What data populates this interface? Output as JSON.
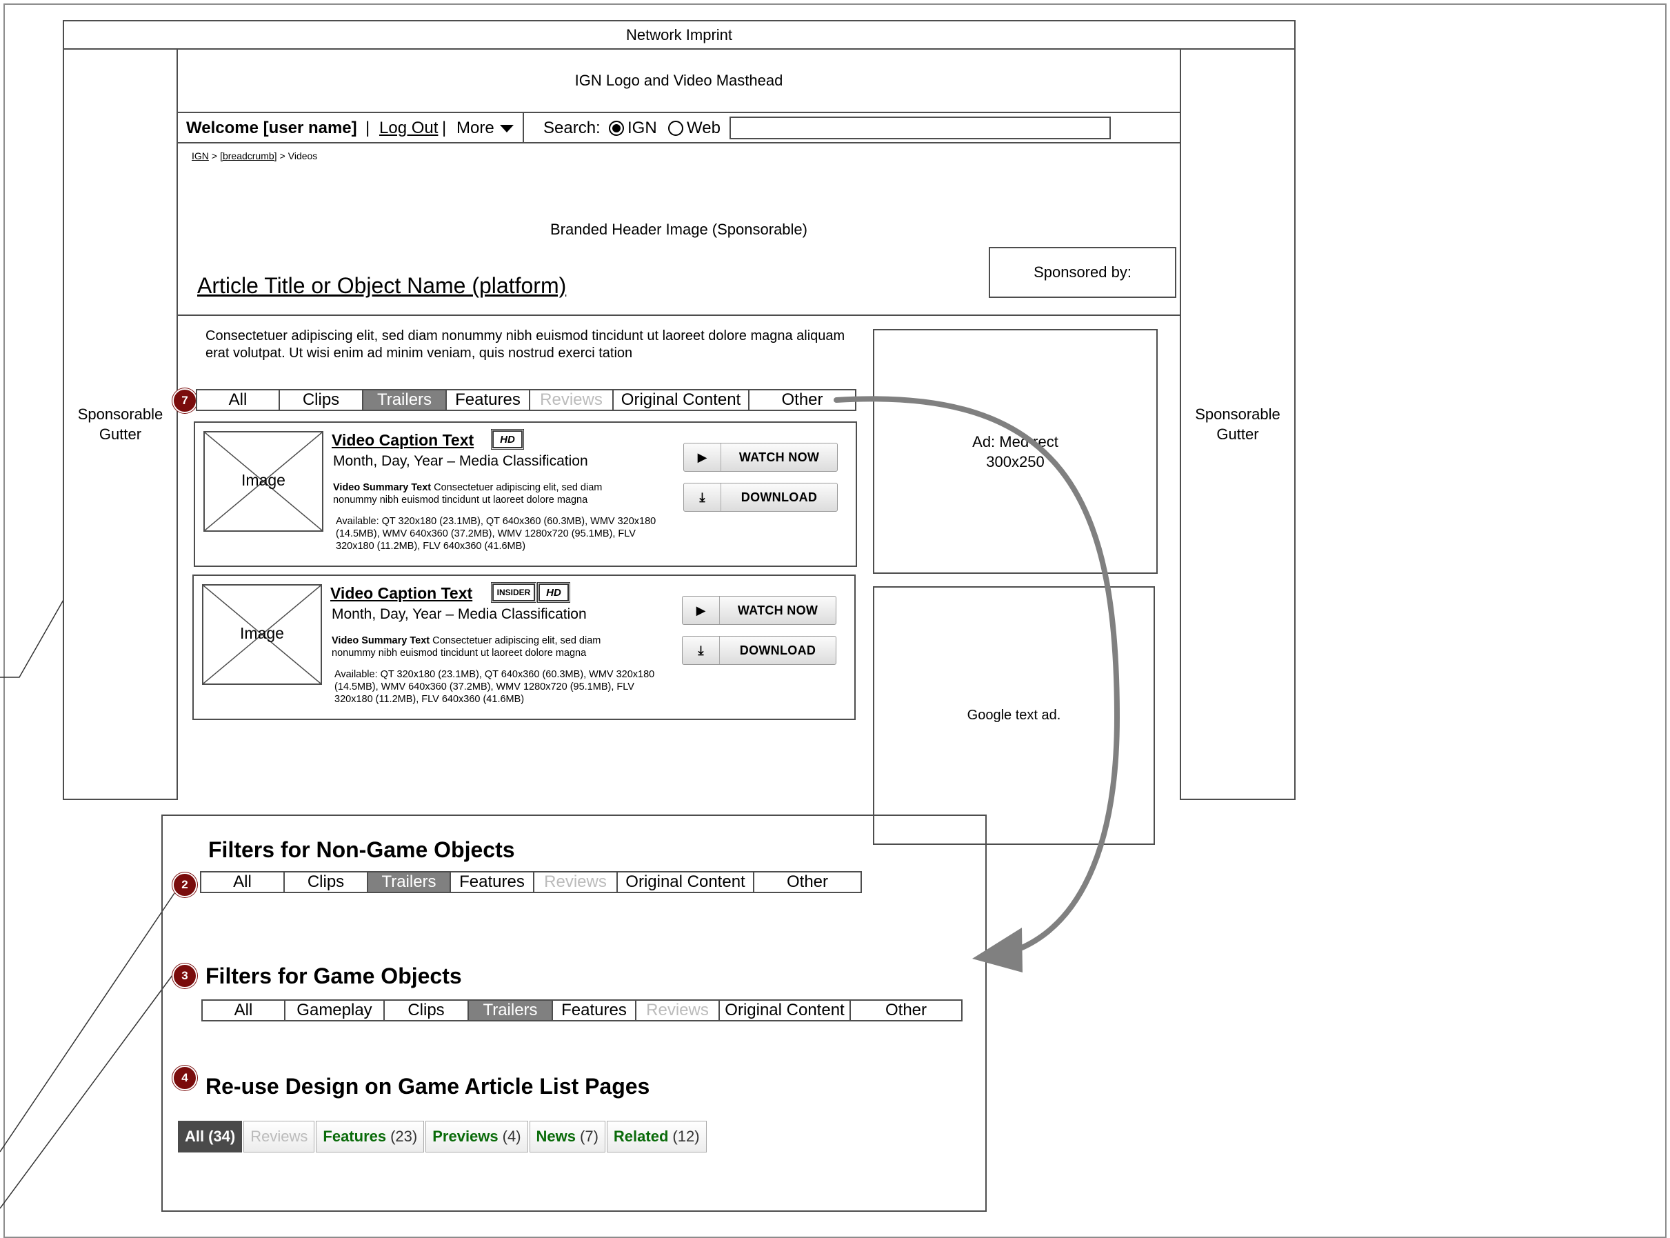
{
  "header": {
    "network_imprint": "Network Imprint",
    "masthead": "IGN Logo and Video Masthead"
  },
  "gutters": {
    "left": "Sponsorable Gutter",
    "right": "Sponsorable Gutter"
  },
  "userbar": {
    "welcome": "Welcome [user name]",
    "sep1": "|",
    "logout": "Log Out",
    "sep2": "|",
    "more": "More",
    "search_label": "Search:",
    "radio_ign": "IGN",
    "radio_web": "Web",
    "search_value": ""
  },
  "breadcrumb": {
    "root": "IGN",
    "sep1": ">",
    "middle": "[breadcrumb]",
    "sep2": ">",
    "current": "Videos"
  },
  "banner": {
    "branded_header": "Branded Header Image (Sponsorable)",
    "title": "Article Title or Object Name (platform)",
    "sponsored_by": "Sponsored by:"
  },
  "intro_text": "Consectetuer adipiscing elit, sed diam nonummy nibh euismod tincidunt ut laoreet dolore magna aliquam erat volutpat. Ut wisi enim ad minim veniam, quis nostrud exerci tation",
  "main_filters": {
    "marker": "7",
    "tabs": [
      {
        "label": "All",
        "state": "normal"
      },
      {
        "label": "Clips",
        "state": "normal"
      },
      {
        "label": "Trailers",
        "state": "active"
      },
      {
        "label": "Features",
        "state": "normal"
      },
      {
        "label": "Reviews",
        "state": "disabled"
      },
      {
        "label": "Original Content",
        "state": "normal"
      },
      {
        "label": "Other",
        "state": "normal"
      }
    ]
  },
  "videos": [
    {
      "image": "Image",
      "caption": "Video Caption Text",
      "badges": [
        "HD"
      ],
      "date_line": "Month, Day, Year – Media Classification",
      "summary_label": "Video Summary Text",
      "summary": "Consectetuer adipiscing elit, sed diam nonummy nibh euismod tincidunt ut laoreet dolore magna",
      "available": "Available: QT 320x180 (23.1MB), QT 640x360 (60.3MB), WMV 320x180 (14.5MB), WMV 640x360 (37.2MB), WMV 1280x720 (95.1MB), FLV 320x180 (11.2MB), FLV 640x360 (41.6MB)",
      "watch": "WATCH NOW",
      "download": "DOWNLOAD"
    },
    {
      "image": "Image",
      "caption": "Video Caption Text",
      "badges": [
        "INSIDER",
        "HD"
      ],
      "date_line": "Month, Day, Year – Media Classification",
      "summary_label": "Video Summary Text",
      "summary": "Consectetuer adipiscing elit, sed diam nonummy nibh euismod tincidunt ut laoreet dolore magna",
      "available": "Available: QT 320x180 (23.1MB), QT 640x360 (60.3MB), WMV 320x180 (14.5MB), WMV 640x360 (37.2MB), WMV 1280x720 (95.1MB), FLV 320x180 (11.2MB), FLV 640x360 (41.6MB)",
      "watch": "WATCH NOW",
      "download": "DOWNLOAD"
    }
  ],
  "ads": {
    "med_rect": "Ad: Med rect\n300x250",
    "google": "Google text ad."
  },
  "panel": {
    "non_game_title": "Filters for Non-Game Objects",
    "non_game_marker": "2",
    "non_game_tabs": [
      {
        "label": "All",
        "state": "normal"
      },
      {
        "label": "Clips",
        "state": "normal"
      },
      {
        "label": "Trailers",
        "state": "active"
      },
      {
        "label": "Features",
        "state": "normal"
      },
      {
        "label": "Reviews",
        "state": "disabled"
      },
      {
        "label": "Original Content",
        "state": "normal"
      },
      {
        "label": "Other",
        "state": "normal"
      }
    ],
    "game_title": "Filters for Game Objects",
    "game_marker": "3",
    "game_tabs": [
      {
        "label": "All",
        "state": "normal"
      },
      {
        "label": "Gameplay",
        "state": "normal"
      },
      {
        "label": "Clips",
        "state": "normal"
      },
      {
        "label": "Trailers",
        "state": "active"
      },
      {
        "label": "Features",
        "state": "normal"
      },
      {
        "label": "Reviews",
        "state": "disabled"
      },
      {
        "label": "Original Content",
        "state": "normal"
      },
      {
        "label": "Other",
        "state": "normal"
      }
    ],
    "reuse_title": "Re-use Design on Game Article List Pages",
    "reuse_marker": "4",
    "reuse_tabs": [
      {
        "label": "All",
        "count": "(34)",
        "state": "active"
      },
      {
        "label": "Reviews",
        "count": "",
        "state": "disabled"
      },
      {
        "label": "Features",
        "count": "(23)",
        "state": "normal"
      },
      {
        "label": "Previews",
        "count": "(4)",
        "state": "normal"
      },
      {
        "label": "News",
        "count": "(7)",
        "state": "normal"
      },
      {
        "label": "Related",
        "count": "(12)",
        "state": "normal"
      }
    ]
  },
  "colors": {
    "marker": "#7a0c0c",
    "active_tab": "#808080",
    "disabled_text": "#bbbbbb",
    "reuse_green": "#0a6b0a",
    "arrow": "#808080"
  }
}
